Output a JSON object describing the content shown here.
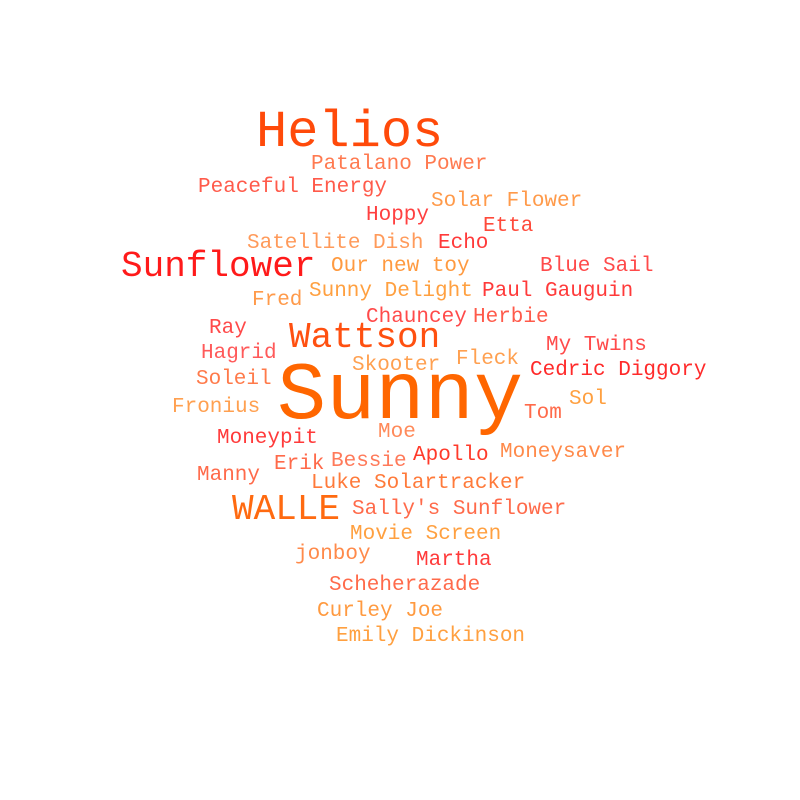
{
  "words": [
    {
      "text": "Helios",
      "color": "#ff4a0a"
    },
    {
      "text": "Patalano Power",
      "color": "#ff7a50"
    },
    {
      "text": "Peaceful Energy",
      "color": "#ff5a4a"
    },
    {
      "text": "Solar Flower",
      "color": "#ff9a4a"
    },
    {
      "text": "Hoppy",
      "color": "#ff4040"
    },
    {
      "text": "Etta",
      "color": "#ff4a3a"
    },
    {
      "text": "Satellite Dish",
      "color": "#ff9a5a"
    },
    {
      "text": "Echo",
      "color": "#ff3a3a"
    },
    {
      "text": "Sunflower",
      "color": "#ff1a1a"
    },
    {
      "text": "Our new toy",
      "color": "#ff9a40"
    },
    {
      "text": "Blue Sail",
      "color": "#ff4a4a"
    },
    {
      "text": "Fred",
      "color": "#ff9a4a"
    },
    {
      "text": "Sunny Delight",
      "color": "#ffa040"
    },
    {
      "text": "Paul Gauguin",
      "color": "#ff3a3a"
    },
    {
      "text": "Chauncey",
      "color": "#ff4a4a"
    },
    {
      "text": "Herbie",
      "color": "#ff5a4a"
    },
    {
      "text": "Ray",
      "color": "#ff4a4a"
    },
    {
      "text": "Wattson",
      "color": "#ff5010"
    },
    {
      "text": "My Twins",
      "color": "#ff4a4a"
    },
    {
      "text": "Hagrid",
      "color": "#ff5a5a"
    },
    {
      "text": "Skooter",
      "color": "#ffa050"
    },
    {
      "text": "Fleck",
      "color": "#ffa050"
    },
    {
      "text": "Cedric Diggory",
      "color": "#ff2a2a"
    },
    {
      "text": "Soleil",
      "color": "#ff7a4a"
    },
    {
      "text": "Sunny",
      "color": "#ff6600"
    },
    {
      "text": "Sol",
      "color": "#ffa040"
    },
    {
      "text": "Fronius",
      "color": "#ffa050"
    },
    {
      "text": "Tom",
      "color": "#ff6a4a"
    },
    {
      "text": "Moe",
      "color": "#ff8a5a"
    },
    {
      "text": "Moneypit",
      "color": "#ff3a3a"
    },
    {
      "text": "Apollo",
      "color": "#ff3a2a"
    },
    {
      "text": "Moneysaver",
      "color": "#ff8a4a"
    },
    {
      "text": "Erik",
      "color": "#ff6a4a"
    },
    {
      "text": "Bessie",
      "color": "#ff7a5a"
    },
    {
      "text": "Manny",
      "color": "#ff6a4a"
    },
    {
      "text": "Luke Solartracker",
      "color": "#ff7a3a"
    },
    {
      "text": "WALLE",
      "color": "#ff6a10"
    },
    {
      "text": "Sally's Sunflower",
      "color": "#ff6a4a"
    },
    {
      "text": "Movie Screen",
      "color": "#ffa040"
    },
    {
      "text": "jonboy",
      "color": "#ff8a4a"
    },
    {
      "text": "Martha",
      "color": "#ff3a3a"
    },
    {
      "text": "Scheherazade",
      "color": "#ff6a4a"
    },
    {
      "text": "Curley Joe",
      "color": "#ff9a40"
    },
    {
      "text": "Emily Dickinson",
      "color": "#ffa040"
    }
  ]
}
